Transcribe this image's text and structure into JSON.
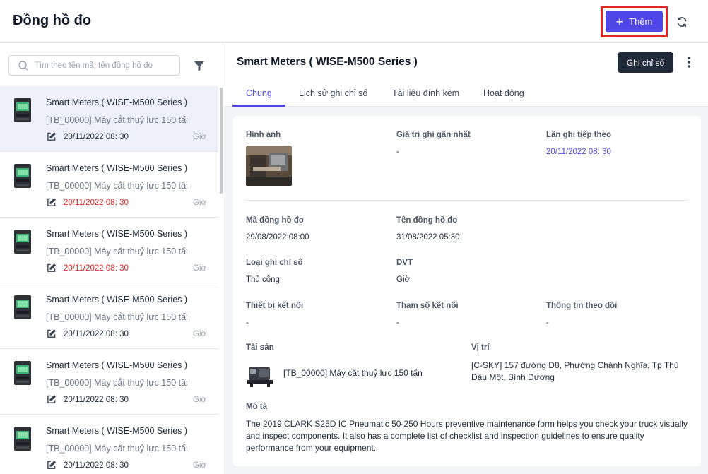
{
  "header": {
    "title": "Đồng hồ đo",
    "add_label": "Thêm"
  },
  "sidebar": {
    "search_placeholder": "Tìm theo tên mã, tên đồng hồ đo",
    "items": [
      {
        "name": "Smart Meters ( WISE-M500 Series )",
        "asset": "[TB_00000] Máy cắt thuỷ lực 150 tấn",
        "date": "20/11/2022 08: 30",
        "unit": "Giờ",
        "overdue": false
      },
      {
        "name": "Smart Meters ( WISE-M500 Series )",
        "asset": "[TB_00000] Máy cắt thuỷ lực 150 tấn",
        "date": "20/11/2022 08: 30",
        "unit": "Giờ",
        "overdue": true
      },
      {
        "name": "Smart Meters ( WISE-M500 Series )",
        "asset": "[TB_00000] Máy cắt thuỷ lực 150 tấn",
        "date": "20/11/2022 08: 30",
        "unit": "Giờ",
        "overdue": true
      },
      {
        "name": "Smart Meters ( WISE-M500 Series )",
        "asset": "[TB_00000] Máy cắt thuỷ lực 150 tấn",
        "date": "20/11/2022 08: 30",
        "unit": "Giờ",
        "overdue": false
      },
      {
        "name": "Smart Meters ( WISE-M500 Series )",
        "asset": "[TB_00000] Máy cắt thuỷ lực 150 tấn",
        "date": "20/11/2022 08: 30",
        "unit": "Giờ",
        "overdue": false
      },
      {
        "name": "Smart Meters ( WISE-M500 Series )",
        "asset": "[TB_00000] Máy cắt thuỷ lực 150 tấn",
        "date": "20/11/2022 08: 30",
        "unit": "Giờ",
        "overdue": false
      }
    ]
  },
  "detail": {
    "title": "Smart Meters ( WISE-M500 Series )",
    "record_label": "Ghi chỉ số",
    "tabs": [
      "Chung",
      "Lịch sử ghi chỉ số",
      "Tài liệu đính kèm",
      "Hoạt động"
    ],
    "image_label": "Hình ảnh",
    "latest_value_label": "Giá trị ghi gần nhất",
    "latest_value": "-",
    "next_reading_label": "Lần ghi tiếp theo",
    "next_reading": "20/11/2022 08: 30",
    "code_label": "Mã đồng hồ đo",
    "code": "29/08/2022 08:00",
    "name_label": "Tên đồng hồ đo",
    "name": "31/08/2022 05:30",
    "reading_type_label": "Loại ghi chỉ số",
    "reading_type": "Thủ công",
    "unit_label": "DVT",
    "unit": "Giờ",
    "device_label": "Thiết bị kết nối",
    "device": "-",
    "param_label": "Tham số kết nối",
    "param": "-",
    "tracking_label": "Thông tin theo dõi",
    "tracking": "-",
    "asset_label": "Tài sản",
    "asset": "[TB_00000] Máy cắt thuỷ lực 150 tấn",
    "location_label": "Vị trí",
    "location": "[C-SKY] 157 đường D8, Phường Chánh Nghĩa, Tp Thủ Dầu Một, Bình Dương",
    "description_label": "Mô tả",
    "description": "The 2019 CLARK S25D IC Pneumatic 50-250 Hours preventive maintenance form helps you check your truck visually and inspect components. It also has a complete list of checklist and inspection guidelines to ensure quality performance from your equipment."
  },
  "colors": {
    "accent": "#4f46e5",
    "overdue": "#dc2626",
    "highlight": "#e5261f"
  }
}
